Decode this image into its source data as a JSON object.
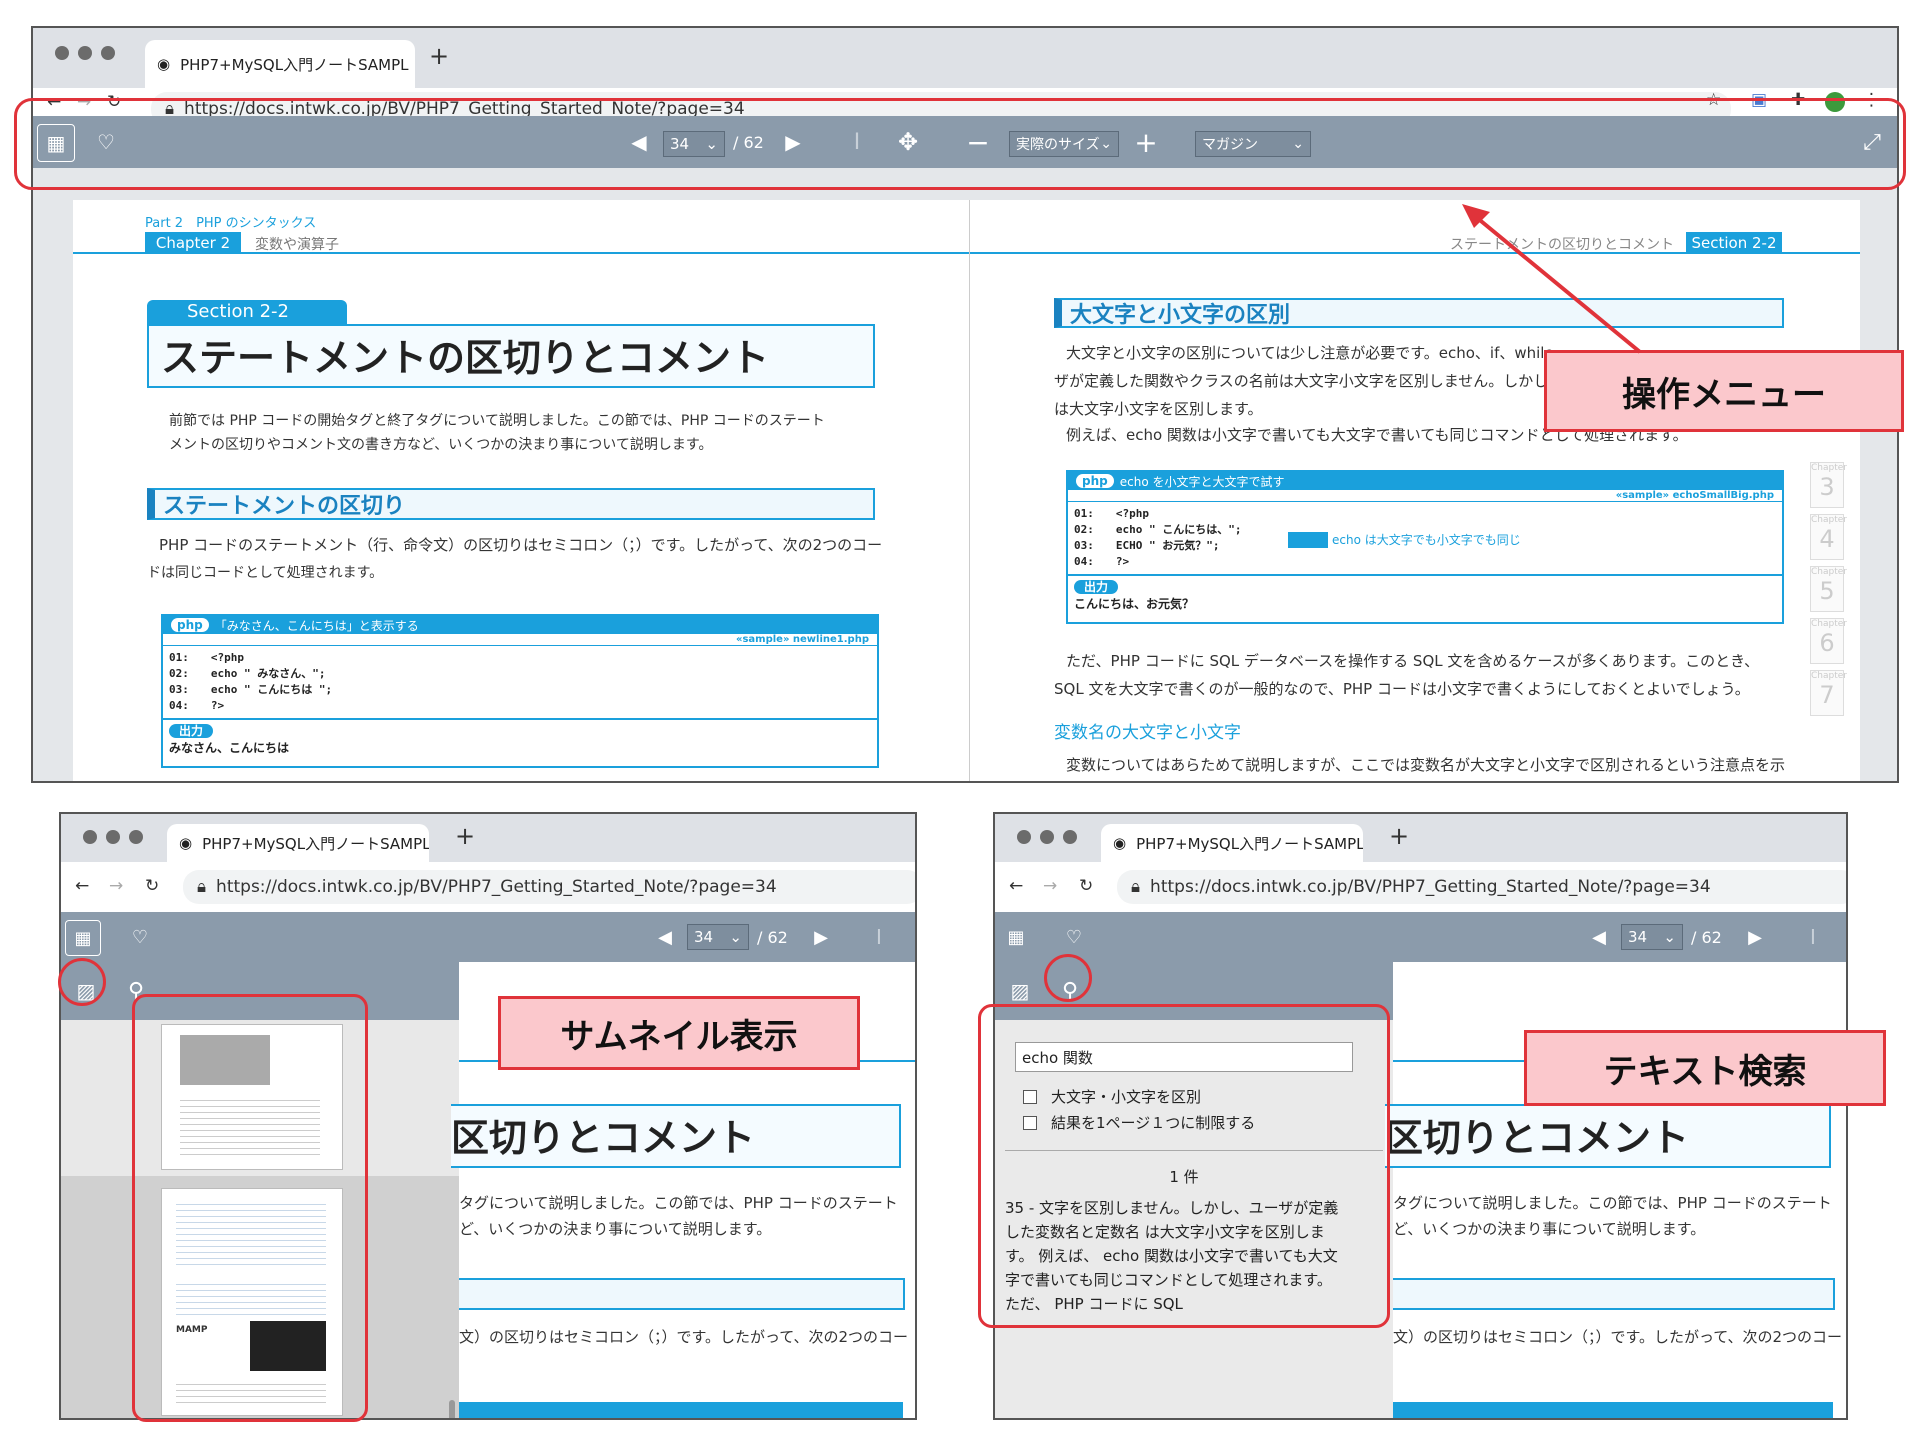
{
  "browser": {
    "tab_title": "PHP7+MySQL入門ノートSAMPL",
    "tab_close": "×",
    "new_tab": "+",
    "url_short": "https://docs.intwk.co.jp/BV/PHP7_Getting_Started_Note/?page=34",
    "url": "https://docs.intwk.co.jp/BV/PHP7_Getting_Started_Note/?page=34"
  },
  "viewer": {
    "page_current": "34",
    "page_total": "/ 62",
    "zoom_select": "実際のサイズ",
    "mode_select": "マガジン"
  },
  "book_left": {
    "part": "Part 2　PHP のシンタックス",
    "chapter_badge": "Chapter 2",
    "chapter_title": "変数や演算子",
    "section_badge": "Section 2-2",
    "section_title": "ステートメントの区切りとコメント",
    "intro_1": "前節では PHP コードの開始タグと終了タグについて説明しました。この節では、PHP コードのステート",
    "intro_2": "メントの区切りやコメント文の書き方など、いくつかの決まり事について説明します。",
    "h2": "ステートメントの区切り",
    "p1_1": "PHP コードのステートメント（行、命令文）の区切りはセミコロン（；）です。したがって、次の2つのコー",
    "p1_2": "ドは同じコードとして処理されます。",
    "code_badge": "php",
    "code_title": "「みなさん、こんにちは」と表示する",
    "code_sample": "«sample» newline1.php",
    "code_lines": [
      "01:　　<?php",
      "02:　　echo \" みなさん、\";",
      "03:　　echo \" こんにちは \";",
      "04:　　?>"
    ],
    "output_badge": "出力",
    "output_text": "みなさん、こんにちは"
  },
  "book_right": {
    "header_title": "ステートメントの区切りとコメント",
    "section_badge": "Section 2-2",
    "h2": "大文字と小文字の区別",
    "p1_1": "大文字と小文字の区別については少し注意が必要です。echo、if、while",
    "p1_2": "ザが定義した関数やクラスの名前は大文字小文字を区別しません。しかし",
    "p1_3": "は大文字小文字を区別します。",
    "p1_4": "例えば、echo 関数は小文字で書いても大文字で書いても同じコマンドとして処理されます。",
    "code_badge": "php",
    "code_title": "echo を小文字と大文字で試す",
    "code_sample": "«sample» echoSmallBig.php",
    "code_lines": [
      "01:　　<?php",
      "02:　　echo \" こんにちは、\";",
      "03:　　ECHO \" お元気？\";",
      "04:　　?>"
    ],
    "code_note": "echo は大文字でも小文字でも同じ",
    "output_badge": "出力",
    "output_text": "こんにちは、お元気？",
    "p2_1": "ただ、PHP コードに SQL データベースを操作する SQL 文を含めるケースが多くあります。このとき、",
    "p2_2": "SQL 文を大文字で書くのが一般的なので、PHP コードは小文字で書くようにしておくとよいでしょう。",
    "h3": "変数名の大文字と小文字",
    "p3": "変数についてはあらためて説明しますが、ここでは変数名が大文字と小文字で区別されるという注意点を示",
    "chapter_label": "Chapter",
    "chapters": [
      "3",
      "4",
      "5",
      "6",
      "7"
    ]
  },
  "callouts": {
    "menu": "操作メニュー",
    "thumb": "サムネイル表示",
    "search": "テキスト検索"
  },
  "search_panel": {
    "query": "echo 関数",
    "opt1": "大文字・小文字を区別",
    "opt2": "結果を1ページ１つに制限する",
    "count": "1 件",
    "result_1": "35 - 文字を区別しません。しかし、ユーザが定義",
    "result_2": "した変数名と定数名 は大文字小文字を区別しま",
    "result_3": "す。 例えば、 echo 関数は小文字で書いても大文",
    "result_4": "字で書いても同じコマンドとして処理されます。",
    "result_5": "ただ、 PHP コードに SQL"
  },
  "zoomed_page": {
    "title_fragment": "区切りとコメント",
    "line1": "タグについて説明しました。この節では、PHP コードのステート",
    "line2": "ど、いくつかの決まり事について説明します。",
    "line3": "文）の区切りはセミコロン（；）です。したがって、次の2つのコー"
  },
  "thumb_logo": "MAMP",
  "colors": {
    "accent": "#1aa0dc",
    "viewer_bar": "#8b9bab",
    "callout_bg": "#fbc8cc",
    "callout_border": "#e0333a"
  }
}
